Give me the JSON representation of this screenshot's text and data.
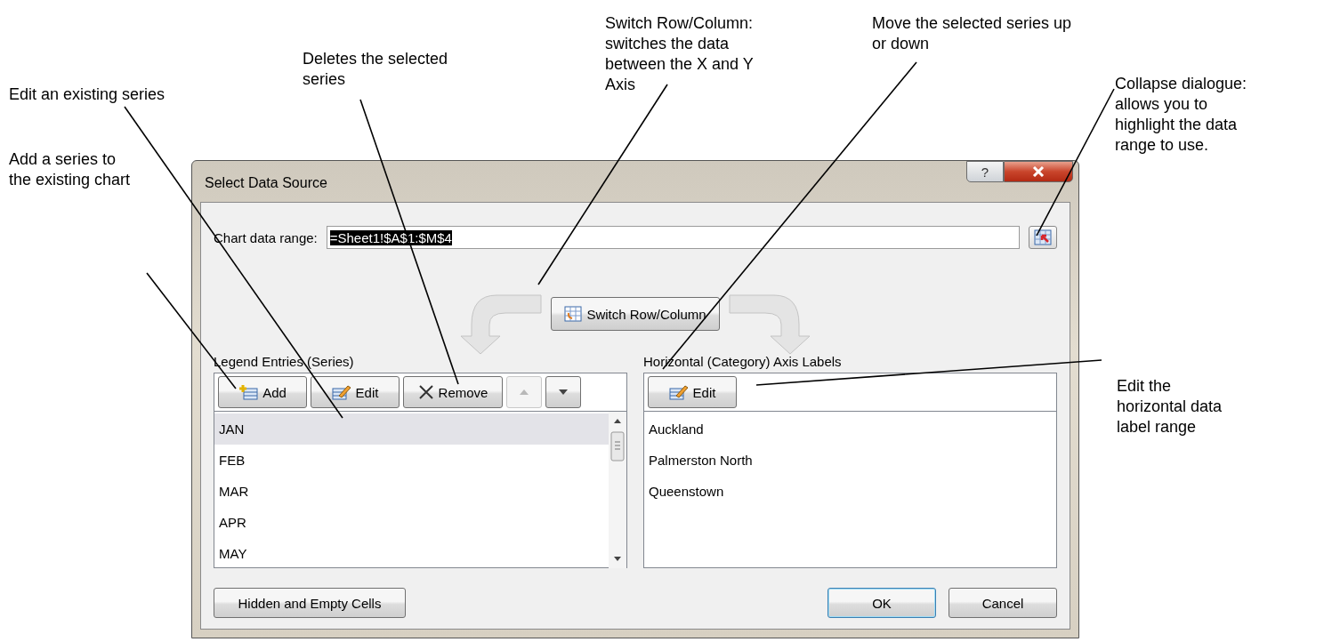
{
  "annotations": [
    {
      "text": "Edit an existing series"
    },
    {
      "text": "Deletes the selected series"
    },
    {
      "text": "Switch Row/Column: switches the data between the X and Y Axis"
    },
    {
      "text": "Move the selected series up or down"
    },
    {
      "text": "Collapse dialogue: allows you to highlight the data range to use."
    },
    {
      "text": "Add a series to the existing chart"
    },
    {
      "text": "Edit the horizontal data label range"
    }
  ],
  "window": {
    "title": "Select Data Source",
    "help": "?"
  },
  "chart_data_range": {
    "label": "Chart data range:",
    "value": "=Sheet1!$A$1:$M$4"
  },
  "switch_button": "Switch Row/Column",
  "legend": {
    "label": "Legend Entries (Series)",
    "buttons": [
      {
        "label": "Add",
        "kind": "add"
      },
      {
        "label": "Edit",
        "kind": "edit"
      },
      {
        "label": "Remove",
        "kind": "remove"
      }
    ],
    "move_buttons": [
      {
        "kind": "up",
        "disabled": true
      },
      {
        "kind": "down",
        "disabled": false
      }
    ],
    "items": [
      {
        "label": "JAN",
        "selected": true
      },
      {
        "label": "FEB",
        "selected": false
      },
      {
        "label": "MAR",
        "selected": false
      },
      {
        "label": "APR",
        "selected": false
      },
      {
        "label": "MAY",
        "selected": false
      }
    ]
  },
  "axis": {
    "label": "Horizontal (Category) Axis Labels",
    "edit_button": "Edit",
    "items": [
      {
        "label": "Auckland"
      },
      {
        "label": "Palmerston North"
      },
      {
        "label": "Queenstown"
      }
    ]
  },
  "footer": {
    "hidden_button": "Hidden and Empty Cells",
    "ok": "OK",
    "cancel": "Cancel"
  }
}
